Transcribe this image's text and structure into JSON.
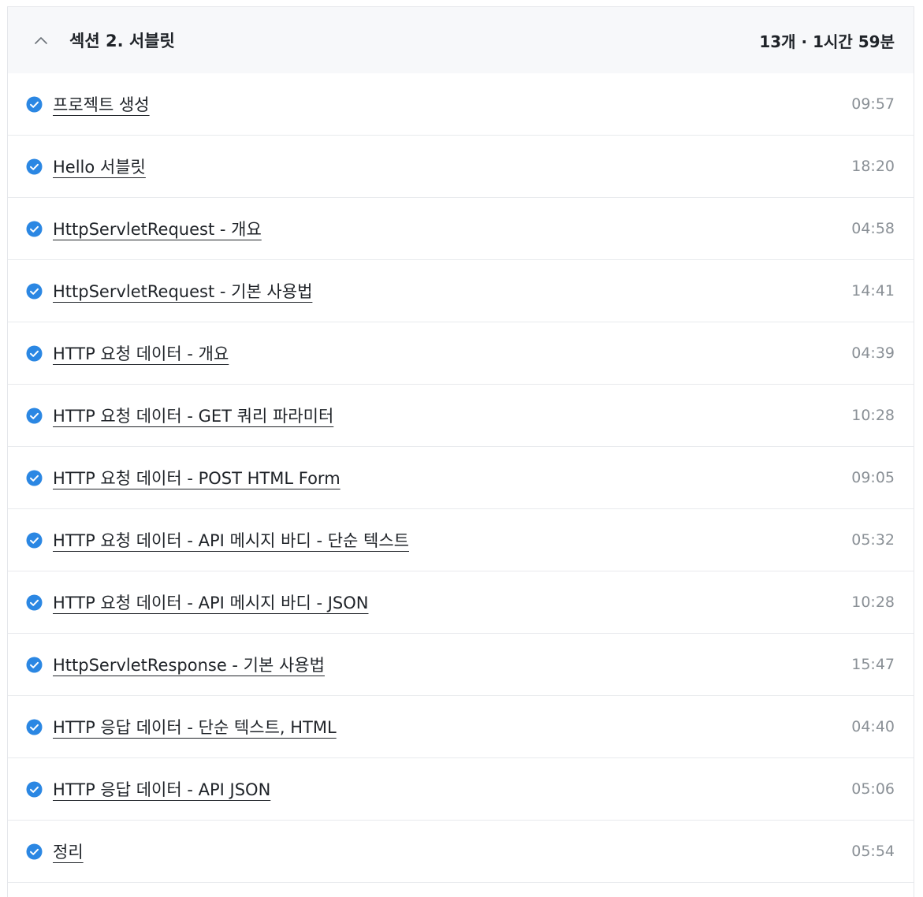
{
  "section": {
    "title": "섹션 2. 서블릿",
    "meta": "13개 · 1시간 59분",
    "expanded": true
  },
  "colors": {
    "check": "#2b87e3",
    "header_bg": "#f7f8fa",
    "time": "#8a9096"
  },
  "lessons": [
    {
      "title": "프로젝트 생성",
      "time": "09:57",
      "completed": true
    },
    {
      "title": "Hello 서블릿",
      "time": "18:20",
      "completed": true
    },
    {
      "title": "HttpServletRequest - 개요",
      "time": "04:58",
      "completed": true
    },
    {
      "title": "HttpServletRequest - 기본 사용법",
      "time": "14:41",
      "completed": true
    },
    {
      "title": "HTTP 요청 데이터 - 개요",
      "time": "04:39",
      "completed": true
    },
    {
      "title": "HTTP 요청 데이터 - GET 쿼리 파라미터",
      "time": "10:28",
      "completed": true
    },
    {
      "title": "HTTP 요청 데이터 - POST HTML Form",
      "time": "09:05",
      "completed": true
    },
    {
      "title": "HTTP 요청 데이터 - API 메시지 바디 - 단순 텍스트",
      "time": "05:32",
      "completed": true
    },
    {
      "title": "HTTP 요청 데이터 - API 메시지 바디 - JSON",
      "time": "10:28",
      "completed": true
    },
    {
      "title": "HttpServletResponse - 기본 사용법",
      "time": "15:47",
      "completed": true
    },
    {
      "title": "HTTP 응답 데이터 - 단순 텍스트, HTML",
      "time": "04:40",
      "completed": true
    },
    {
      "title": "HTTP 응답 데이터 - API JSON",
      "time": "05:06",
      "completed": true
    },
    {
      "title": "정리",
      "time": "05:54",
      "completed": true
    }
  ]
}
